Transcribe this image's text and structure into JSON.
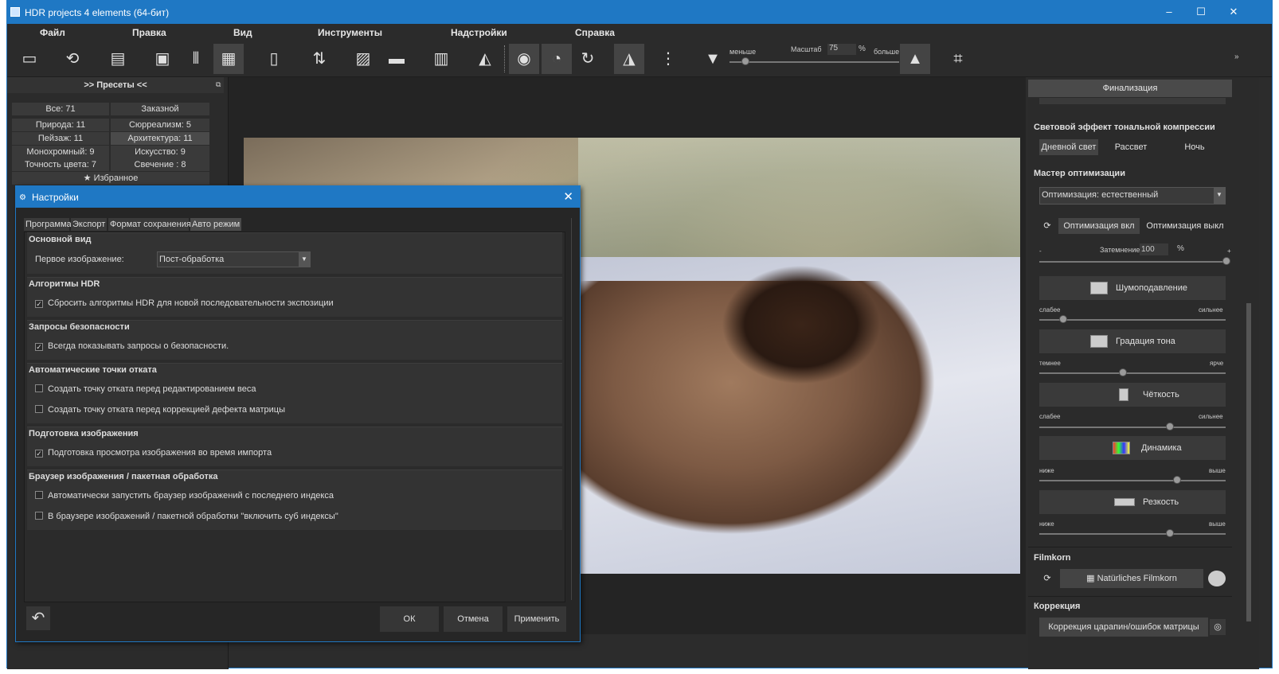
{
  "window": {
    "title": "HDR projects 4 elements (64-бит)",
    "min": "–",
    "max": "☐",
    "close": "✕"
  },
  "menu": [
    "Файл",
    "Правка",
    "Вид",
    "Инструменты",
    "Надстройки",
    "Справка"
  ],
  "toolbar": {
    "scale_label": "Масштаб",
    "scale_value": "75",
    "scale_unit": "%",
    "less": "меньше",
    "more": "больше"
  },
  "presets": {
    "header": ">> Пресеты <<",
    "items": [
      "Все: 71",
      "Заказной",
      "Природа: 11",
      "Сюрреализм: 5",
      "Пейзаж: 11",
      "Архитектура: 11",
      "Монохромный: 9",
      "Искусство: 9",
      "Точность цвета: 7",
      "Свечение   : 8"
    ],
    "favorites": "Избранное"
  },
  "right": {
    "header": "Финализация",
    "tone_title": "Световой эффект тональной компрессии",
    "tone_buttons": [
      "Дневной свет",
      "Рассвет",
      "Ночь"
    ],
    "opt_title": "Мастер оптимизации",
    "opt_select": "Оптимизация: естественный",
    "opt_on": "Оптимизация вкл",
    "opt_off": "Оптимизация выкл",
    "dim_label": "Затемнение",
    "dim_value": "100",
    "dim_unit": "%",
    "dim_minus": "-",
    "dim_plus": "+",
    "noise": "Шумоподавление",
    "noise_lo": "слабее",
    "noise_hi": "сильнее",
    "noise_level": 0.13,
    "tone": "Градация тона",
    "tone_lo": "темнее",
    "tone_hi": "ярче",
    "tone_level": 0.45,
    "clarity": "Чёткость",
    "clarity_lo": "слабее",
    "clarity_hi": "сильнее",
    "clarity_level": 0.7,
    "dynamic": "Динамика",
    "dynamic_lo": "ниже",
    "dynamic_hi": "выше",
    "dynamic_level": 0.74,
    "sharp": "Резкость",
    "sharp_lo": "ниже",
    "sharp_hi": "выше",
    "sharp_level": 0.7,
    "film_title": "Filmkorn",
    "film_btn": "Natürliches Filmkorn",
    "corr_title": "Коррекция",
    "corr_btn": "Коррекция царапин/ошибок матрицы"
  },
  "dialog": {
    "title": "Настройки",
    "tabs": [
      "Программа",
      "Экспорт",
      "Формат сохранения",
      "Авто режим"
    ],
    "s1_title": "Основной вид",
    "s1_label": "Первое изображение:",
    "s1_value": "Пост-обработка",
    "s2_title": "Алгоритмы HDR",
    "s2_cb": "Сбросить алгоритмы HDR для новой последовательности экспозиции",
    "s3_title": "Запросы безопасности",
    "s3_cb": "Всегда показывать запросы о безопасности.",
    "s4_title": "Автоматические точки отката",
    "s4_cb1": "Создать точку отката перед редактированием веса",
    "s4_cb2": "Создать точку отката перед коррекцией дефекта матрицы",
    "s5_title": "Подготовка изображения",
    "s5_cb": "Подготовка просмотра изображения во время импорта",
    "s6_title": "Браузер изображения / пакетная обработка",
    "s6_cb1": "Автоматически запустить браузер изображений с последнего индекса",
    "s6_cb2": "В браузере изображений / пакетной обработки \"включить суб индексы\"",
    "ok": "ОК",
    "cancel": "Отмена",
    "apply": "Применить"
  }
}
